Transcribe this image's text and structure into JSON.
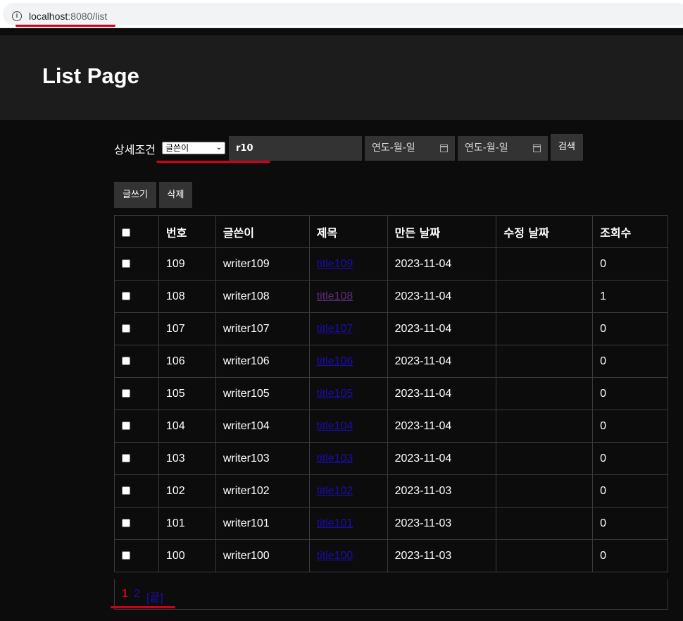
{
  "browser": {
    "url_host": "localhost",
    "url_rest": ":8080/list"
  },
  "header": {
    "title": "List Page"
  },
  "search": {
    "label": "상세조건",
    "select_value": "글쓴이",
    "input_value": "r10",
    "date_from_placeholder": "연도-월-일",
    "date_to_placeholder": "연도-월-일",
    "search_button": "검색"
  },
  "actions": {
    "write_button": "글쓰기",
    "delete_button": "삭제"
  },
  "table": {
    "headers": [
      "번호",
      "글쓴이",
      "제목",
      "만든 날짜",
      "수정 날짜",
      "조회수"
    ],
    "rows": [
      {
        "no": "109",
        "writer": "writer109",
        "title": "title109",
        "created": "2023-11-04",
        "modified": "",
        "views": "0",
        "visited": false
      },
      {
        "no": "108",
        "writer": "writer108",
        "title": "title108",
        "created": "2023-11-04",
        "modified": "",
        "views": "1",
        "visited": true
      },
      {
        "no": "107",
        "writer": "writer107",
        "title": "title107",
        "created": "2023-11-04",
        "modified": "",
        "views": "0",
        "visited": false
      },
      {
        "no": "106",
        "writer": "writer106",
        "title": "title106",
        "created": "2023-11-04",
        "modified": "",
        "views": "0",
        "visited": false
      },
      {
        "no": "105",
        "writer": "writer105",
        "title": "title105",
        "created": "2023-11-04",
        "modified": "",
        "views": "0",
        "visited": false
      },
      {
        "no": "104",
        "writer": "writer104",
        "title": "title104",
        "created": "2023-11-04",
        "modified": "",
        "views": "0",
        "visited": false
      },
      {
        "no": "103",
        "writer": "writer103",
        "title": "title103",
        "created": "2023-11-04",
        "modified": "",
        "views": "0",
        "visited": false
      },
      {
        "no": "102",
        "writer": "writer102",
        "title": "title102",
        "created": "2023-11-03",
        "modified": "",
        "views": "0",
        "visited": false
      },
      {
        "no": "101",
        "writer": "writer101",
        "title": "title101",
        "created": "2023-11-03",
        "modified": "",
        "views": "0",
        "visited": false
      },
      {
        "no": "100",
        "writer": "writer100",
        "title": "title100",
        "created": "2023-11-03",
        "modified": "",
        "views": "0",
        "visited": false
      }
    ]
  },
  "pagination": {
    "current": "1",
    "next": "2",
    "last": "[끝]"
  },
  "colors": {
    "annotation_red": "#d0021b",
    "link_blue": "#1a0dab",
    "link_visited": "#5e2b7e"
  },
  "icons": {
    "info": "info-circle-icon",
    "select": "chevron-down-icon",
    "date": "calendar-icon"
  }
}
